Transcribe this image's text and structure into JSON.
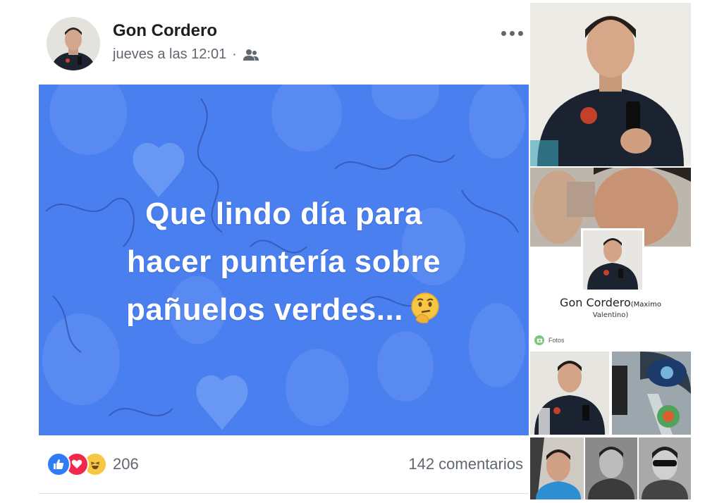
{
  "post": {
    "author": "Gon Cordero",
    "timestamp": "jueves a las 12:01",
    "separator": "·",
    "audience_icon": "friends-icon",
    "menu_icon": "more-options-icon",
    "banner": {
      "lines": [
        "Que lindo día para",
        "hacer puntería sobre",
        "pañuelos verdes..."
      ],
      "emoji": "thinking-face-icon",
      "background": "#4a7ff0"
    },
    "reactions": {
      "icons": [
        "like-icon",
        "love-icon",
        "haha-icon"
      ],
      "count": "206"
    },
    "comments": "142 comentarios"
  },
  "sidebar": {
    "profile_name": "Gon Cordero",
    "profile_name_extra": "(Maximo",
    "profile_name_extra2": "Valentino)",
    "photos_label": "Fotos"
  }
}
